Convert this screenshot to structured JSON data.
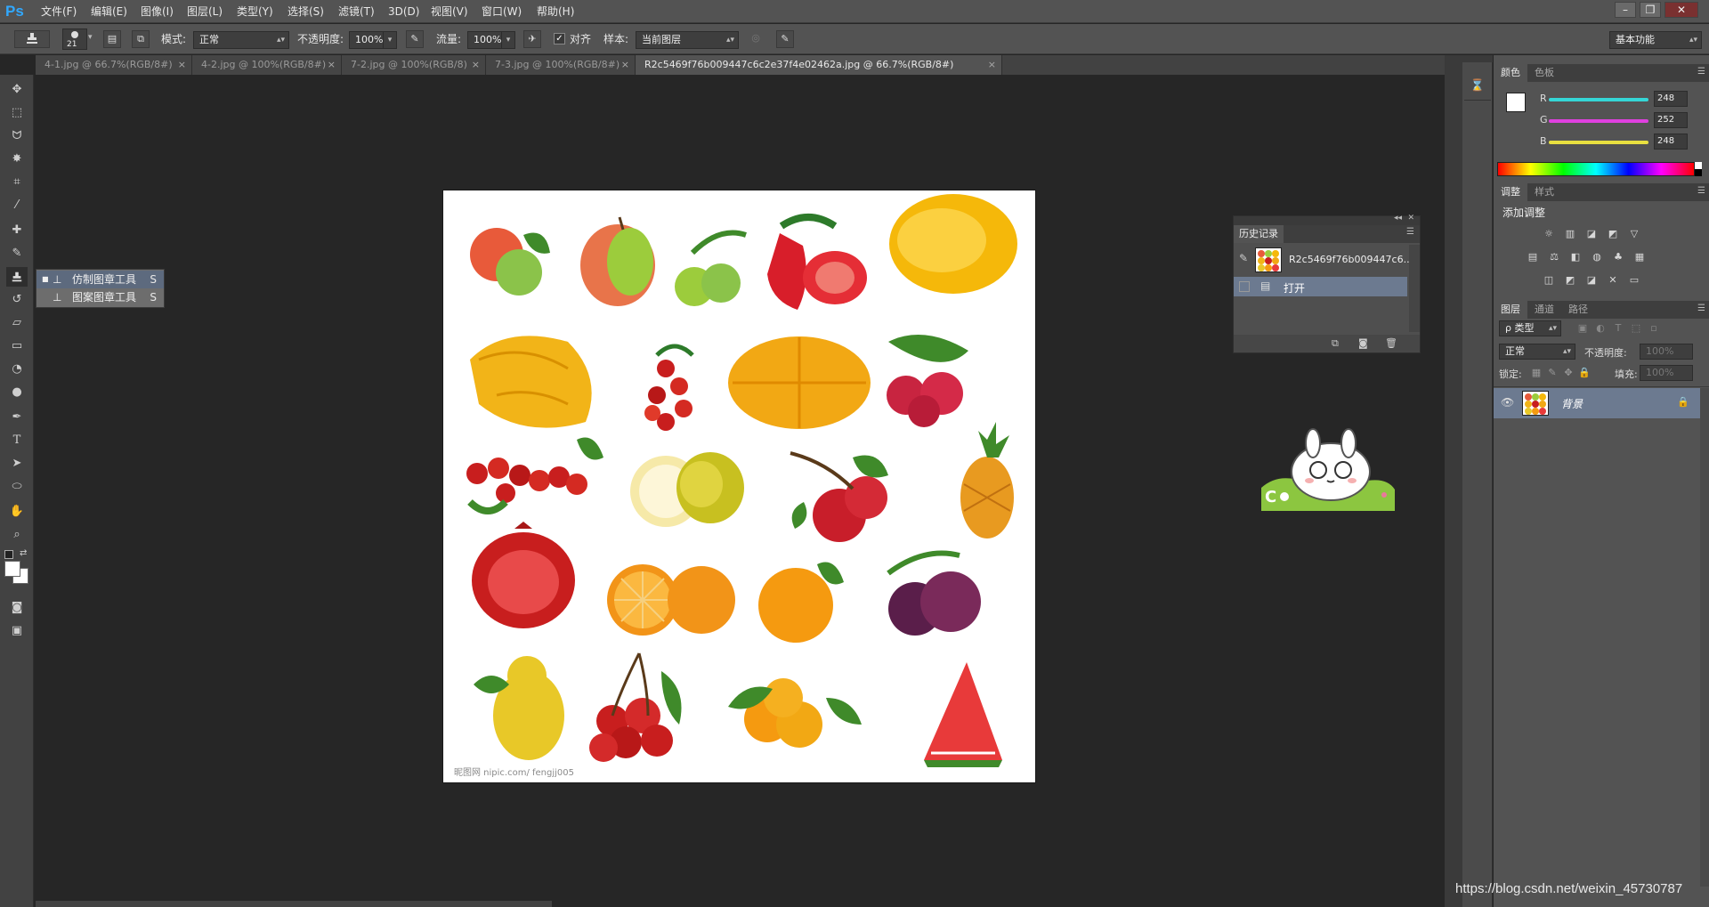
{
  "app": {
    "logo": "Ps"
  },
  "menu": [
    "文件(F)",
    "编辑(E)",
    "图像(I)",
    "图层(L)",
    "类型(Y)",
    "选择(S)",
    "滤镜(T)",
    "3D(D)",
    "视图(V)",
    "窗口(W)",
    "帮助(H)"
  ],
  "window_controls": {
    "minimize": "–",
    "restore": "❐",
    "close": "✕"
  },
  "options": {
    "brush_size": "21",
    "mode_label": "模式:",
    "mode_value": "正常",
    "opacity_label": "不透明度:",
    "opacity_value": "100%",
    "flow_label": "流量:",
    "flow_value": "100%",
    "aligned_label": "对齐",
    "aligned_checked": "✓",
    "sample_label": "样本:",
    "sample_value": "当前图层",
    "workspace": "基本功能"
  },
  "tabs": [
    {
      "label": "4-1.jpg @ 66.7%(RGB/8#)",
      "active": false
    },
    {
      "label": "4-2.jpg @ 100%(RGB/8#)",
      "active": false
    },
    {
      "label": "7-2.jpg @ 100%(RGB/8)",
      "active": false
    },
    {
      "label": "7-3.jpg @ 100%(RGB/8#)",
      "active": false
    },
    {
      "label": "R2c5469f76b009447c6c2e37f4e02462a.jpg @ 66.7%(RGB/8#)",
      "active": true
    }
  ],
  "tab_close": "×",
  "flyout": {
    "items": [
      {
        "label": "仿制图章工具",
        "shortcut": "S",
        "selected": true
      },
      {
        "label": "图案图章工具",
        "shortcut": "S",
        "selected": false
      }
    ]
  },
  "canvas": {
    "watermark": "昵图网 nipic.com/ fengjj005"
  },
  "history": {
    "title": "历史记录",
    "snapshot_label": "R2c5469f76b009447c6...",
    "step": "打开"
  },
  "color_panel": {
    "tabs": [
      "颜色",
      "色板"
    ],
    "channels": [
      {
        "name": "R",
        "value": "248",
        "color": "#35d6d6"
      },
      {
        "name": "G",
        "value": "252",
        "color": "#e040e0"
      },
      {
        "name": "B",
        "value": "248",
        "color": "#e8e040"
      }
    ]
  },
  "adjust_panel": {
    "tabs": [
      "调整",
      "样式"
    ],
    "add_label": "添加调整"
  },
  "layers_panel": {
    "tabs": [
      "图层",
      "通道",
      "路径"
    ],
    "filter_label": "ρ 类型",
    "blend": "正常",
    "opacity_label": "不透明度:",
    "opacity_value": "100%",
    "lock_label": "锁定:",
    "fill_label": "填充:",
    "fill_value": "100%",
    "layer_name": "背景"
  },
  "footer_url": "https://blog.csdn.net/weixin_45730787"
}
